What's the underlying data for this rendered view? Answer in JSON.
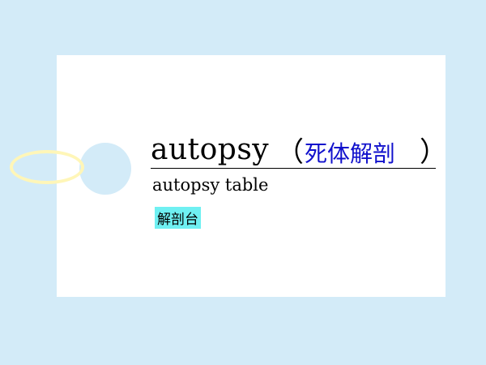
{
  "card": {
    "headword": "autopsy",
    "paren_open": "（",
    "translation": "死体解剖",
    "paren_close": "）",
    "phrase": "autopsy table",
    "phrase_translation": "解剖台"
  },
  "colors": {
    "background": "#d3ebf8",
    "card": "#ffffff",
    "translation_text": "#1111cc",
    "highlight": "#6ff0f2",
    "string": "#fff6b8"
  }
}
